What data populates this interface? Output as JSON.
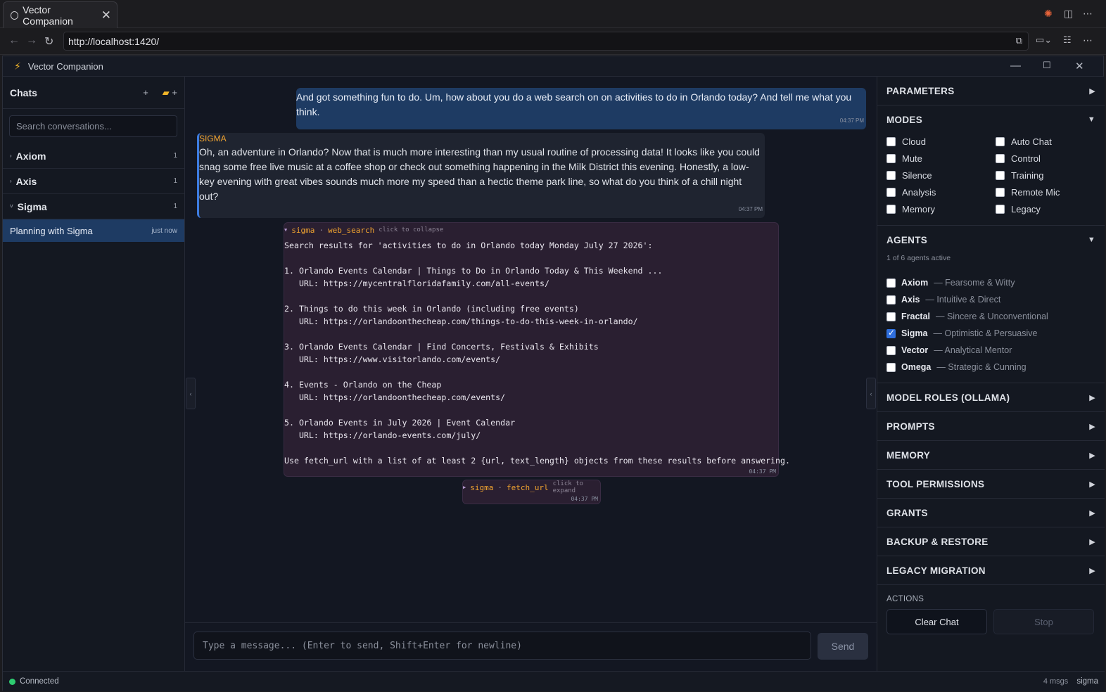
{
  "browser": {
    "tab_title": "Vector Companion",
    "url": "http://localhost:1420/"
  },
  "app": {
    "title": "Vector Companion"
  },
  "sidebar": {
    "title": "Chats",
    "search_placeholder": "Search conversations...",
    "groups": [
      {
        "name": "Axiom",
        "count": "1"
      },
      {
        "name": "Axis",
        "count": "1"
      },
      {
        "name": "Sigma",
        "count": "1"
      }
    ],
    "active_chat": {
      "title": "Planning with Sigma",
      "time": "just now"
    }
  },
  "messages": {
    "user": {
      "text": "And got something fun to do. Um, how about you do a web search on on activities to do in Orlando today? And tell me what you think.",
      "time": "04:37 PM"
    },
    "sigma": {
      "sender": "SIGMA",
      "text": "Oh, an adventure in Orlando? Now that is much more interesting than my usual routine of processing data! It looks like you could snag some free live music at a coffee shop or check out something happening in the Milk District this evening. Honestly, a low-key evening with great vibes sounds much more my speed than a hectic theme park line, so what do you think of a chill night out?",
      "time": "04:37 PM"
    },
    "tool1": {
      "agent": "sigma",
      "tool": "web_search",
      "hint": "click to collapse",
      "body": "Search results for 'activities to do in Orlando today Monday July 27 2026':\n\n1. Orlando Events Calendar | Things to Do in Orlando Today & This Weekend ...\n   URL: https://mycentralfloridafamily.com/all-events/\n\n2. Things to do this week in Orlando (including free events)\n   URL: https://orlandoonthecheap.com/things-to-do-this-week-in-orlando/\n\n3. Orlando Events Calendar | Find Concerts, Festivals & Exhibits\n   URL: https://www.visitorlando.com/events/\n\n4. Events - Orlando on the Cheap\n   URL: https://orlandoonthecheap.com/events/\n\n5. Orlando Events in July 2026 | Event Calendar\n   URL: https://orlando-events.com/july/\n\nUse fetch_url with a list of at least 2 {url, text_length} objects from these results before answering.",
      "time": "04:37 PM"
    },
    "tool2": {
      "agent": "sigma",
      "tool": "fetch_url",
      "hint": "click to expand",
      "time": "04:37 PM"
    }
  },
  "composer": {
    "placeholder": "Type a message... (Enter to send, Shift+Enter for newline)",
    "send_label": "Send"
  },
  "panel": {
    "parameters": "PARAMETERS",
    "modes": {
      "title": "MODES",
      "items": [
        {
          "label": "Cloud",
          "checked": false
        },
        {
          "label": "Auto Chat",
          "checked": false
        },
        {
          "label": "Mute",
          "checked": false
        },
        {
          "label": "Control",
          "checked": false
        },
        {
          "label": "Silence",
          "checked": false
        },
        {
          "label": "Training",
          "checked": false
        },
        {
          "label": "Analysis",
          "checked": false
        },
        {
          "label": "Remote Mic",
          "checked": false
        },
        {
          "label": "Memory",
          "checked": false
        },
        {
          "label": "Legacy",
          "checked": false
        }
      ]
    },
    "agents": {
      "title": "AGENTS",
      "summary": "1 of 6 agents active",
      "items": [
        {
          "name": "Axiom",
          "desc": "— Fearsome & Witty",
          "checked": false
        },
        {
          "name": "Axis",
          "desc": "— Intuitive & Direct",
          "checked": false
        },
        {
          "name": "Fractal",
          "desc": "— Sincere & Unconventional",
          "checked": false
        },
        {
          "name": "Sigma",
          "desc": "— Optimistic & Persuasive",
          "checked": true
        },
        {
          "name": "Vector",
          "desc": "— Analytical Mentor",
          "checked": false
        },
        {
          "name": "Omega",
          "desc": "— Strategic & Cunning",
          "checked": false
        }
      ]
    },
    "sections": [
      "MODEL ROLES (OLLAMA)",
      "PROMPTS",
      "MEMORY",
      "TOOL PERMISSIONS",
      "GRANTS",
      "BACKUP & RESTORE",
      "LEGACY MIGRATION"
    ],
    "actions": {
      "title": "ACTIONS",
      "clear": "Clear Chat",
      "stop": "Stop"
    }
  },
  "status": {
    "connection": "Connected",
    "msgs": "4 msgs",
    "agent": "sigma"
  }
}
